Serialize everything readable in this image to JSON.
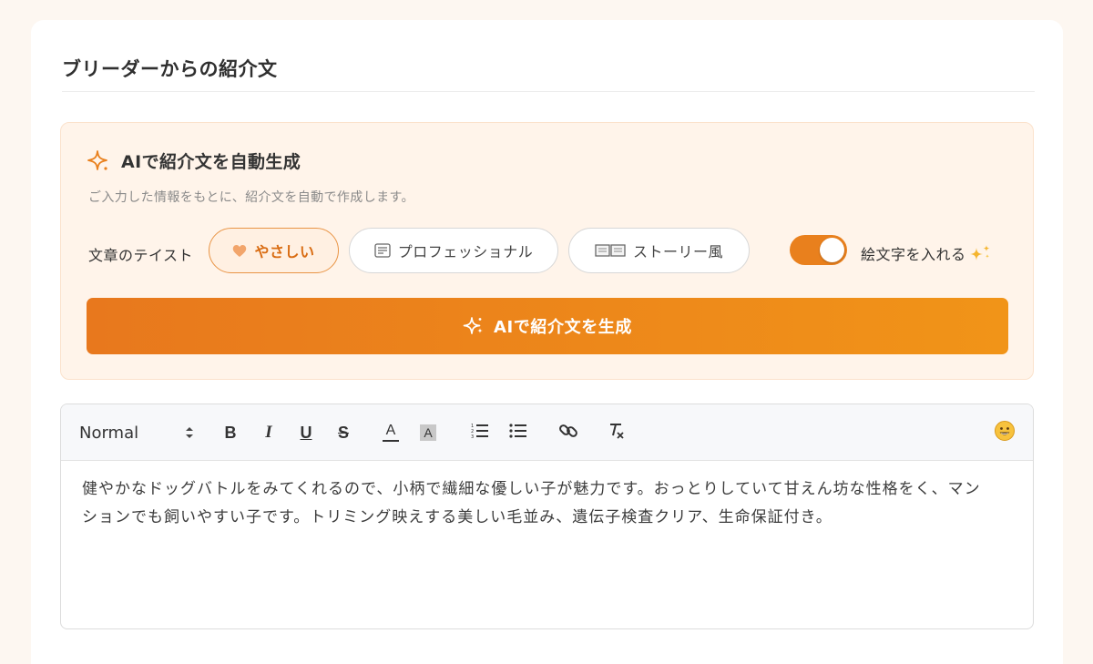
{
  "section": {
    "title": "ブリーダーからの紹介文"
  },
  "ai_panel": {
    "heading": "AIで紹介文を自動生成",
    "description": "ご入力した情報をもとに、紹介文を自動で作成します。",
    "taste_label": "文章のテイスト",
    "tastes": [
      {
        "label": "やさしい",
        "icon": "heart-icon",
        "selected": true
      },
      {
        "label": "プロフェッショナル",
        "icon": "document-icon",
        "selected": false
      },
      {
        "label": "ストーリー風",
        "icon": "book-icon",
        "selected": false
      }
    ],
    "emoji_toggle": {
      "label": "絵文字を入れる",
      "icon": "sparkles-icon",
      "on": true
    },
    "generate_button": "AIで紹介文を生成",
    "accent_color": "#e9801d"
  },
  "editor": {
    "format_select": {
      "value": "Normal"
    },
    "toolbar": {
      "bold": "B",
      "italic": "I",
      "underline": "U",
      "strike": "S",
      "text_color": "A",
      "background_color": "A"
    },
    "content": "健やかなドッグバトルをみてくれるので、小柄で繊細な優しい子が魅力です。おっとりしていて甘えん坊な性格をく、マンションでも飼いやすい子です。トリミング映えする美しい毛並み、遺伝子検査クリア、生命保証付き。"
  }
}
